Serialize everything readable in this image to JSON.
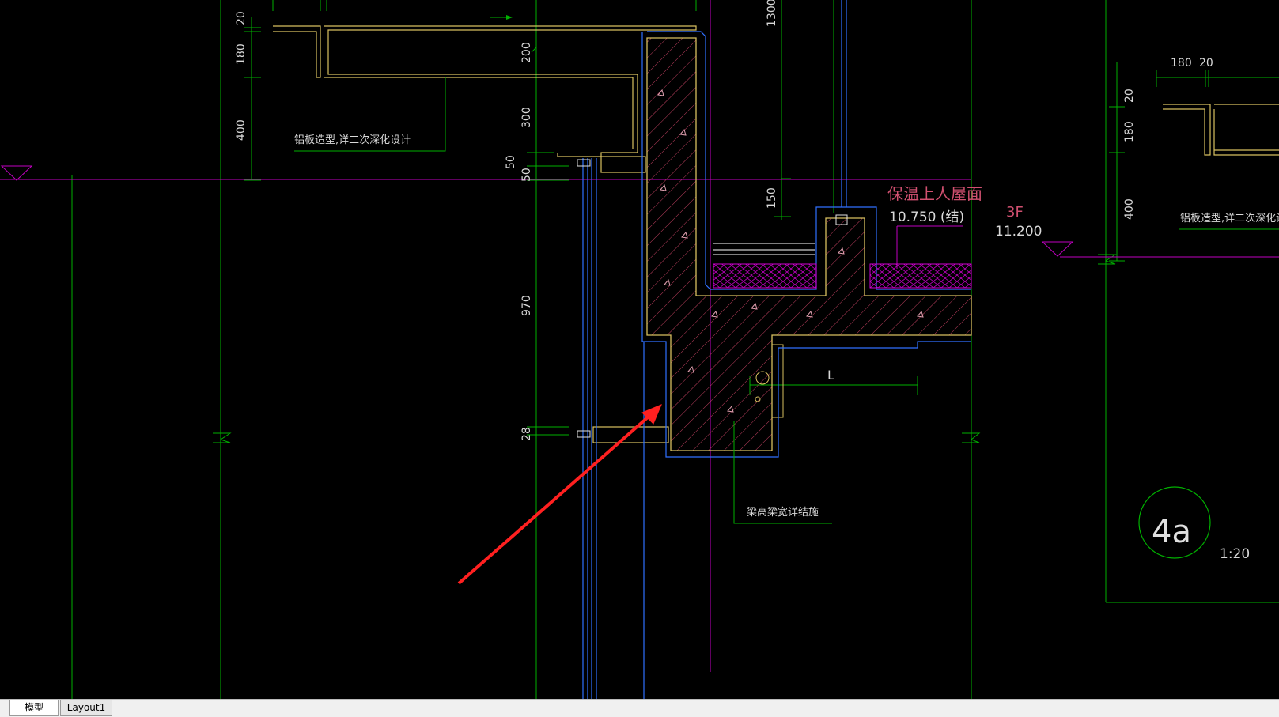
{
  "drawing": {
    "dimensions": {
      "d20_top": "20",
      "d180_top": "180",
      "d400_left": "400",
      "d200": "200",
      "d300": "300",
      "d50_a": "50",
      "d50_b": "50",
      "d970": "970",
      "d28": "28",
      "d1300": "1300",
      "d150": "150",
      "d180_right": "180",
      "d20_right": "20",
      "d20_right_v": "20",
      "d180_right_v": "180",
      "d400_right": "400",
      "dim_L": "L"
    },
    "notes": {
      "aluminum_left": "铝板造型,详二次深化设计",
      "aluminum_right": "铝板造型,详二次深化设计",
      "beam_note": "梁高梁宽详结施"
    },
    "levels": {
      "roof_title": "保温上人屋面",
      "roof_elev": "10.750 (结)",
      "floor_label": "3F",
      "floor_elev": "11.200"
    },
    "detail": {
      "number": "4a",
      "scale": "1:20"
    },
    "colors": {
      "green": "#00b000",
      "yellow": "#d8c060",
      "magenta": "#c000c0",
      "blue": "#3070ff",
      "red": "#ff2020",
      "pink": "#d05070",
      "white": "#e0e0e0"
    }
  },
  "tabs": {
    "model": "模型",
    "layout1": "Layout1"
  }
}
